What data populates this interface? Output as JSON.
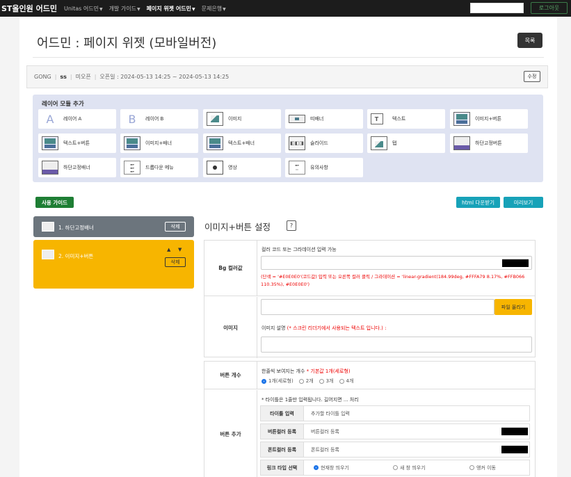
{
  "topnav": {
    "brand": "ST올인원 어드민",
    "items": [
      {
        "label": "Unitas 어드민",
        "active": false
      },
      {
        "label": "개발 가이드",
        "active": false
      },
      {
        "label": "페이지 위젯 어드민",
        "active": true
      },
      {
        "label": "문제은행",
        "active": false
      }
    ],
    "login_label": "로그아웃"
  },
  "page": {
    "title": "어드민 : 페이지 위젯 (모바일버전)",
    "list_button": "목록"
  },
  "info": {
    "name": "GONG",
    "code": "ss",
    "status": "미오픈",
    "period": "오픈일 : 2024-05-13 14:25 ~ 2024-05-13 14:25",
    "edit_button": "수정"
  },
  "layer_modules": {
    "title": "레이어 모듈 추가",
    "modules": [
      {
        "icon": "letter-a-icon",
        "glyph": "A",
        "label": "레이어 A"
      },
      {
        "icon": "letter-b-icon",
        "glyph": "B",
        "label": "레이어 B"
      },
      {
        "icon": "image-icon",
        "glyph": "",
        "label": "이미지"
      },
      {
        "icon": "strip-banner-icon",
        "glyph": "",
        "label": "띠배너"
      },
      {
        "icon": "text-icon",
        "glyph": "T",
        "label": "텍스트"
      },
      {
        "icon": "image-button-icon",
        "glyph": "",
        "label": "이미지+버튼"
      },
      {
        "icon": "text-button-icon",
        "glyph": "",
        "label": "텍스트+버튼"
      },
      {
        "icon": "image-banner-icon",
        "glyph": "",
        "label": "이미지+배너"
      },
      {
        "icon": "text-banner-icon",
        "glyph": "",
        "label": "텍스트+배너"
      },
      {
        "icon": "slide-icon",
        "glyph": "◧◧◨",
        "label": "슬라이드"
      },
      {
        "icon": "tab-icon",
        "glyph": "",
        "label": "탭"
      },
      {
        "icon": "fixed-bottom-button-icon",
        "glyph": "",
        "label": "하단고정버튼"
      },
      {
        "icon": "fixed-bottom-banner-icon",
        "glyph": "",
        "label": "하단고정배너"
      },
      {
        "icon": "dropdown-menu-icon",
        "glyph": "",
        "label": "드롭다운 메뉴"
      },
      {
        "icon": "video-icon",
        "glyph": "",
        "label": "영상"
      },
      {
        "icon": "notice-icon",
        "glyph": "",
        "label": "유의사항"
      }
    ]
  },
  "actions": {
    "guide": "사용 가이드",
    "html_download": "html 다운받기",
    "preview": "미리보기"
  },
  "layers": [
    {
      "label": "1. 하단고정배너",
      "delete": "삭제",
      "color": "#6c757d"
    },
    {
      "label": "2. 이미지+버튼",
      "delete": "삭제",
      "color": "#f7b500",
      "up": "▲",
      "down": "▼"
    }
  ],
  "settings": {
    "title": "이미지+버튼 설정",
    "help": "?",
    "bg": {
      "label": "Bg 컬러값",
      "hint": "컬러 코드 또는 그라데이션 입력 가능",
      "note": "(단색 = '#E0E0E0'(코드값) 입력 또는 오른쪽 컬러 클릭 / 그라데이션 = 'linear-gradient(184.99deg, #FFFA79 8.17%, #FFB066 110.35%), #E0E0E0')",
      "value": "",
      "swatch": "#000000"
    },
    "image": {
      "label": "이미지",
      "upload": "파일 올리기",
      "desc_label": "이미지 설명",
      "desc_note": "(* 스크린 리더기에서 사용되는 텍스트 입니다.) :"
    },
    "button_count": {
      "label": "버튼 개수",
      "hint": "한줄씩 보여지는 개수",
      "default_note": "* 기본값 1개(세로형)",
      "options": [
        "1개(세로형)",
        "2개",
        "3개",
        "4개"
      ],
      "selected": "1개(세로형)"
    },
    "button_add": {
      "label": "버튼 추가",
      "warning": "* 타이틀은 1줄만 입력됩니다. 길어지면 ... 처리",
      "title_label": "타이틀 입력",
      "title_placeholder": "추가할 타이틀 입력",
      "btn_color_label": "버튼컬러 등록",
      "btn_color_placeholder": "버튼컬러 등록",
      "font_color_label": "폰트컬러 등록",
      "font_color_placeholder": "폰트컬러 등록",
      "link_label": "링크 타입 선택",
      "link_options": [
        "현재창 띄우기",
        "새 창 띄우기",
        "앵커 이동"
      ],
      "link_selected": "현재창 띄우기"
    }
  }
}
